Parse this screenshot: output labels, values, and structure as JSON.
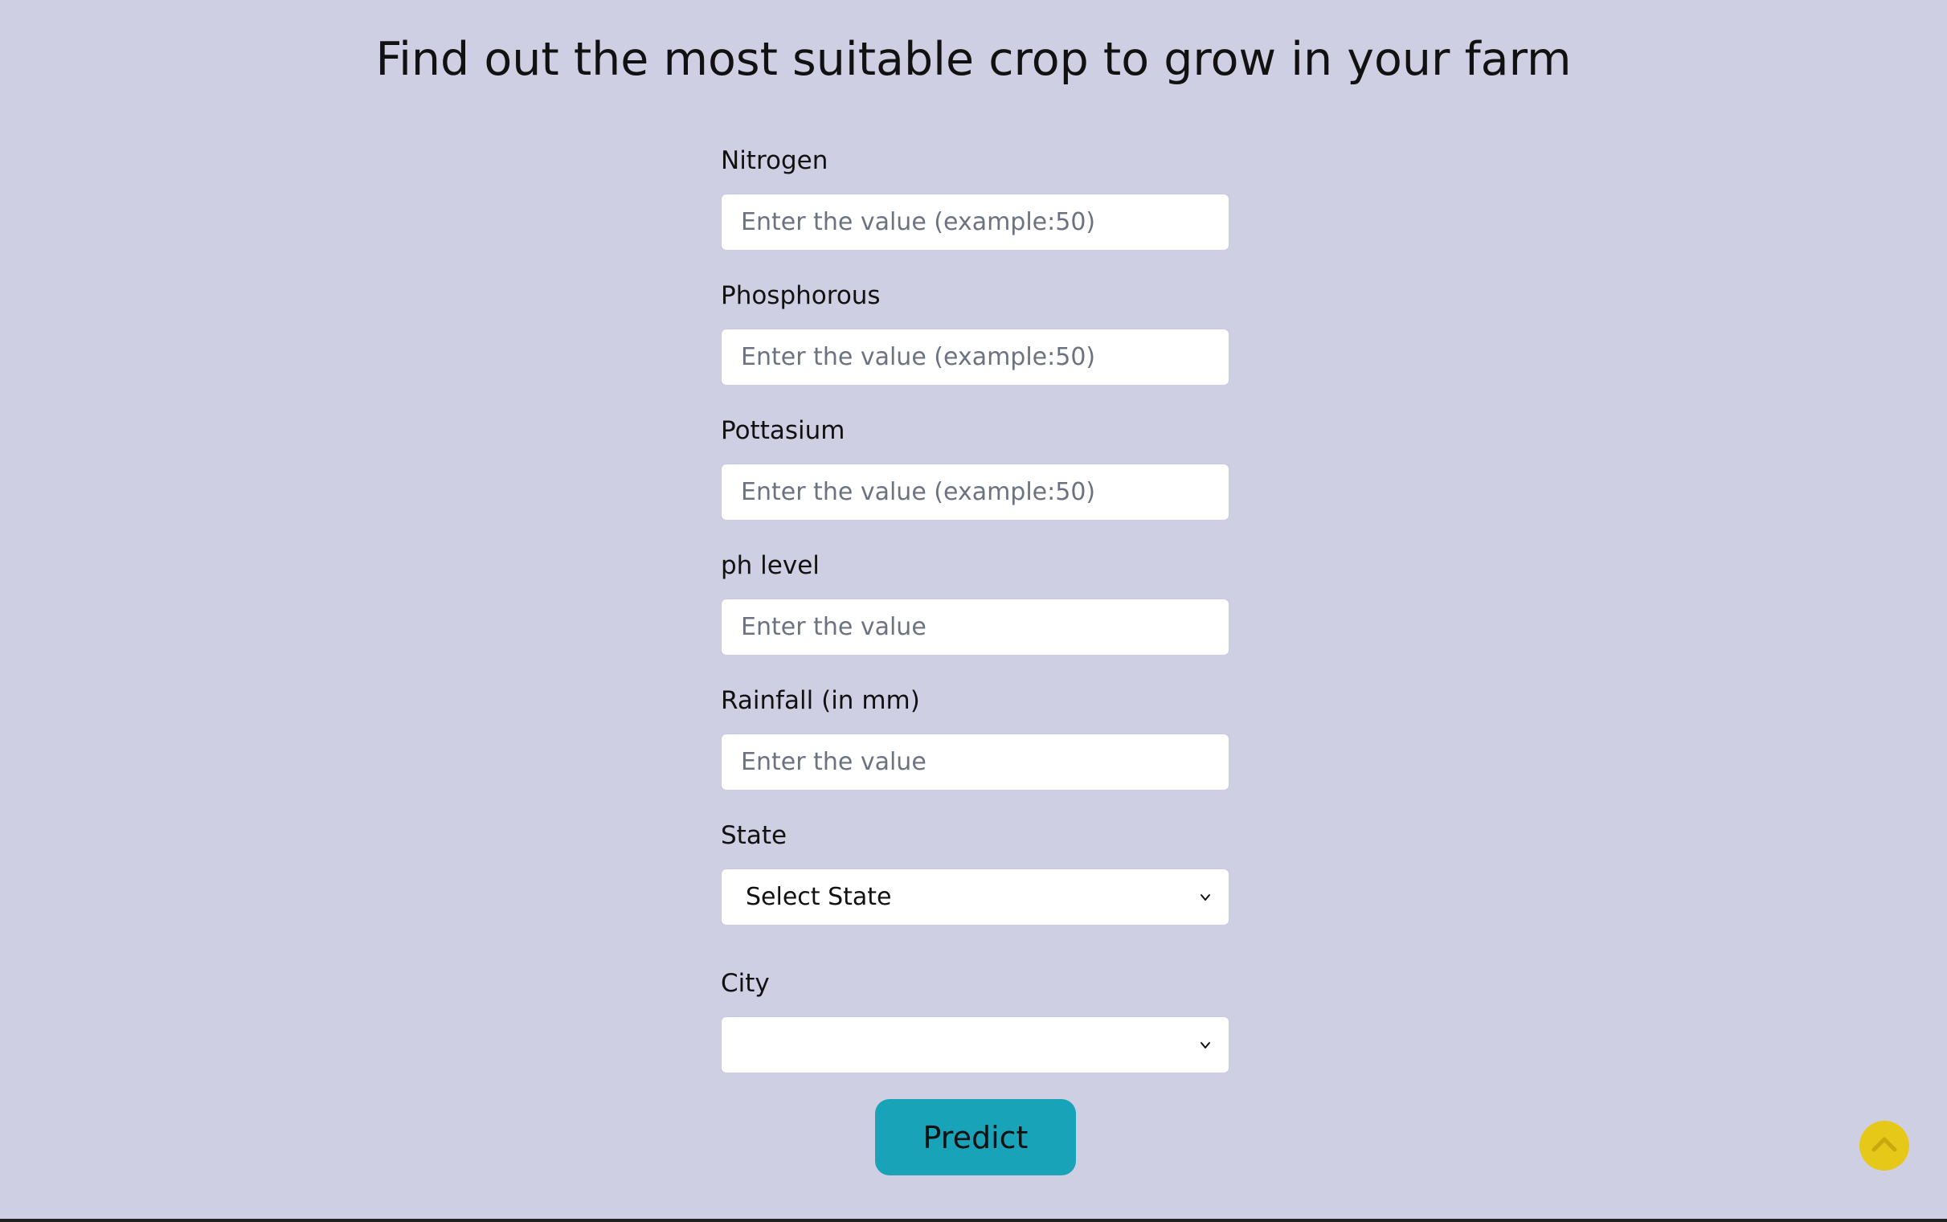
{
  "page": {
    "title": "Find out the most suitable crop to grow in your farm"
  },
  "form": {
    "nitrogen": {
      "label": "Nitrogen",
      "placeholder": "Enter the value (example:50)"
    },
    "phosphorous": {
      "label": "Phosphorous",
      "placeholder": "Enter the value (example:50)"
    },
    "pottasium": {
      "label": "Pottasium",
      "placeholder": "Enter the value (example:50)"
    },
    "ph": {
      "label": "ph level",
      "placeholder": "Enter the value"
    },
    "rainfall": {
      "label": "Rainfall (in mm)",
      "placeholder": "Enter the value"
    },
    "state": {
      "label": "State",
      "selected": "Select State"
    },
    "city": {
      "label": "City",
      "selected": ""
    },
    "submit_label": "Predict"
  },
  "icons": {
    "select_arrow": "chevron-down-icon",
    "scroll_top": "chevron-up-icon"
  },
  "colors": {
    "background": "#cfcfe4",
    "input_background": "#ffffff",
    "placeholder_text": "#6b7280",
    "predict_button": "#19a3b9",
    "scroll_top_button": "#e6c819"
  }
}
